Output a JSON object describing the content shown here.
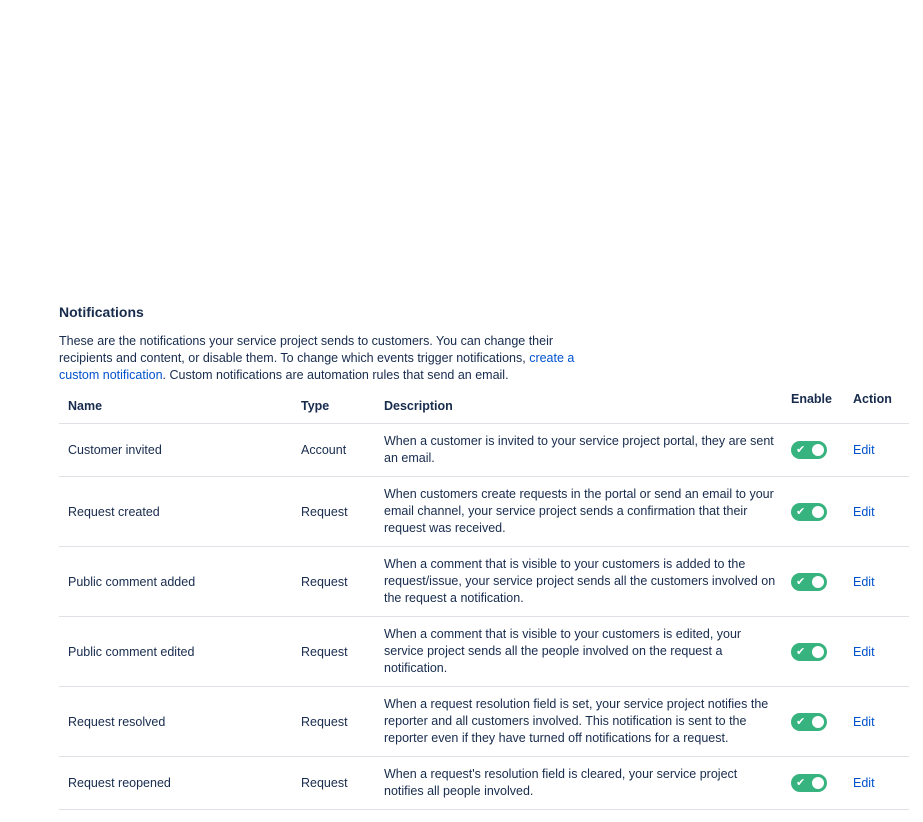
{
  "section": {
    "title": "Notifications",
    "intro_before_link": "These are the notifications your service project sends to customers. You can change their recipients and content, or disable them. To change which events trigger notifications, ",
    "intro_link": "create a custom notification",
    "intro_after_link": ". Custom notifications are automation rules that send an email."
  },
  "table": {
    "headers": {
      "name": "Name",
      "type": "Type",
      "description": "Description",
      "enable": "Enable",
      "action": "Action"
    },
    "rows": [
      {
        "name": "Customer invited",
        "type": "Account",
        "description": "When a customer is invited to your service project portal, they are sent an email.",
        "enabled": true,
        "action": "Edit"
      },
      {
        "name": "Request created",
        "type": "Request",
        "description": "When customers create requests in the portal or send an email to your email channel, your service project sends a confirmation that their request was received.",
        "enabled": true,
        "action": "Edit"
      },
      {
        "name": "Public comment added",
        "type": "Request",
        "description": "When a comment that is visible to your customers is added to the request/issue, your service project sends all the customers involved on the request a notification.",
        "enabled": true,
        "action": "Edit"
      },
      {
        "name": "Public comment edited",
        "type": "Request",
        "description": "When a comment that is visible to your customers is edited, your service project sends all the people involved on the request a notification.",
        "enabled": true,
        "action": "Edit"
      },
      {
        "name": "Request resolved",
        "type": "Request",
        "description": "When a request resolution field is set, your service project notifies the reporter and all customers involved. This notification is sent to the reporter even if they have turned off notifications for a request.",
        "enabled": true,
        "action": "Edit"
      },
      {
        "name": "Request reopened",
        "type": "Request",
        "description": "When a request's resolution field is cleared, your service project notifies all people involved.",
        "enabled": true,
        "action": "Edit"
      }
    ]
  },
  "colors": {
    "toggle_on": "#36b37e",
    "link": "#0052cc",
    "text": "#172b4d",
    "divider": "#dfe1e6"
  },
  "icons": {
    "toggle_check": "check-icon"
  }
}
